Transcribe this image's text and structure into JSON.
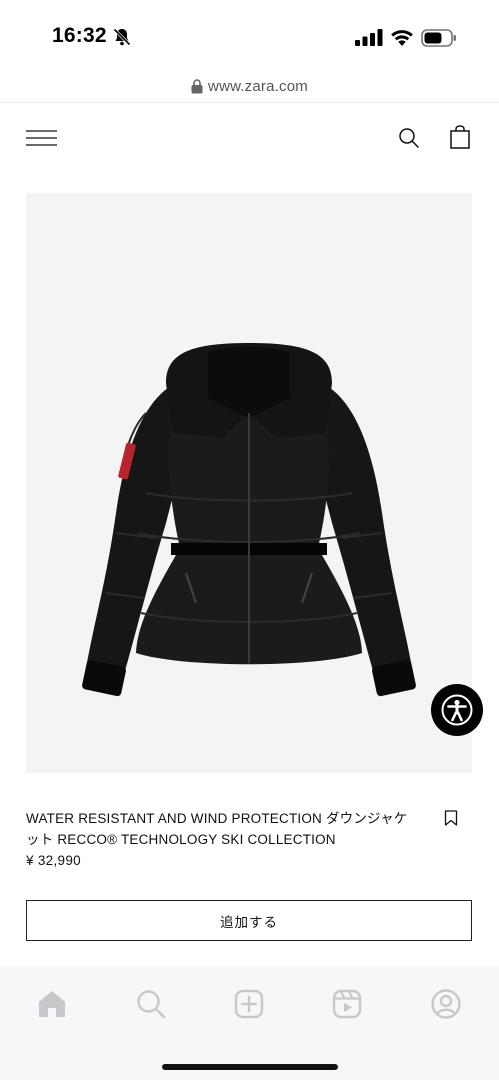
{
  "status_bar": {
    "time": "16:32",
    "icons": [
      "bell-slash-icon",
      "signal-icon",
      "wifi-icon",
      "battery-icon"
    ]
  },
  "browser": {
    "url": "www.zara.com",
    "lock_icon": "lock-icon"
  },
  "header": {
    "menu_icon": "menu-icon",
    "search_icon": "search-icon",
    "bag_icon": "shopping-bag-icon"
  },
  "product": {
    "image_subject": "black hooded down jacket with belt",
    "name": "WATER RESISTANT AND WIND PROTECTION ダウンジャケット RECCO® TECHNOLOGY SKI COLLECTION",
    "price": "¥ 32,990",
    "bookmark_icon": "bookmark-icon",
    "add_button_label": "追加する"
  },
  "accessibility": {
    "icon": "accessibility-icon",
    "color": "#000000"
  },
  "bottom_nav": {
    "items": [
      {
        "icon": "home-icon",
        "active": true
      },
      {
        "icon": "search-icon",
        "active": false
      },
      {
        "icon": "create-icon",
        "active": false
      },
      {
        "icon": "reels-icon",
        "active": false
      },
      {
        "icon": "profile-icon",
        "active": false
      }
    ]
  },
  "colors": {
    "accent": "#111111",
    "image_background": "#f4f4f4",
    "nav_background": "#f7f7f8",
    "nav_icon": "#c8c8cc"
  }
}
